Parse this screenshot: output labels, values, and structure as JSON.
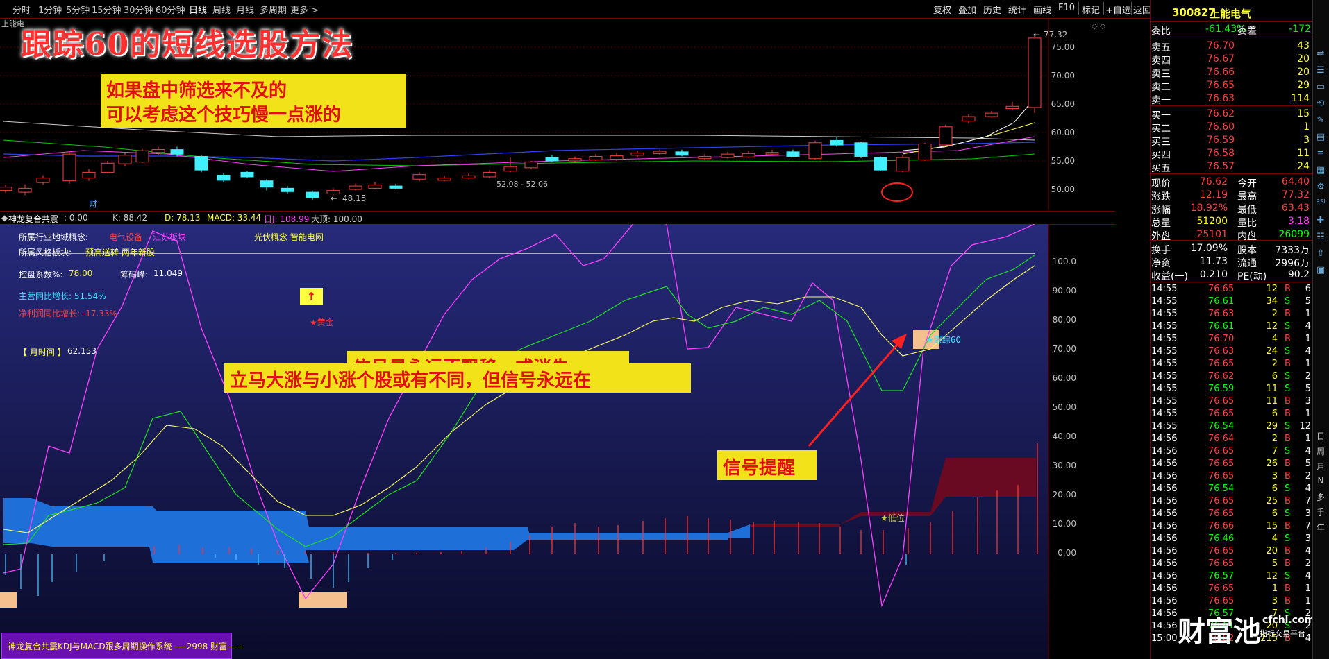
{
  "toolbar": {
    "periods": [
      "分时",
      "1分钟",
      "5分钟",
      "15分钟",
      "30分钟",
      "60分钟",
      "日线",
      "周线",
      "月线",
      "多周期",
      "更多 >"
    ],
    "active_period": "日线",
    "right_buttons": [
      "复权",
      "叠加",
      "历史",
      "统计",
      "画线",
      "F10",
      "标记",
      "+自选",
      "返回"
    ]
  },
  "stock": {
    "code": "300827",
    "name": "上能电气"
  },
  "main_chart": {
    "title_overlay": "跟踪60的短线选股方法",
    "note_line1": "如果盘中筛选来不及的",
    "note_line2": "可以考虑这个技巧慢一点涨的",
    "label_small": "上能电",
    "high_label": "77.32",
    "low_label": "48.15",
    "range_label": "52.08 - 52.06",
    "cai_label": "财",
    "y_ticks": [
      "75.00",
      "70.00",
      "65.00",
      "60.00",
      "55.00",
      "50.00"
    ]
  },
  "info_row": {
    "name": "神龙复合共震",
    "v0": ": 0.00",
    "k": "K: 88.42",
    "d": "D: 78.13",
    "macd": "MACD: 33.44",
    "j": "日J: 108.99",
    "big": "大顶: 100.00"
  },
  "indicator": {
    "industry_label": "所属行业地域概念:",
    "industry_v1": "电气设备",
    "industry_v2": "江苏板块",
    "concept": "光伏概念 智能电网",
    "style_label": "所属风格板块:",
    "style_value": "预高送转 两年新股",
    "control_label": "控盘系数%:",
    "control_value": "78.00",
    "chip_label": "筹码峰:",
    "chip_value": "11.049",
    "main_growth": "主营同比增长: 51.54%",
    "profit_growth": "净利润同比增长: -17.33%",
    "month_label": "【 月时间 】",
    "month_value": "62.153",
    "star_gold": "★黄金",
    "star_low": "★低位",
    "track_label": "跟踪60",
    "signal_text1": "信号是永远不飘移，或消失",
    "signal_text2": "立马大涨与小涨个股或有不同，但信号永远在",
    "signal_remind": "信号提醒",
    "arrow_box": "↑",
    "y_ticks": [
      "100.0",
      "90.00",
      "80.00",
      "70.00",
      "60.00",
      "50.00",
      "40.00",
      "30.00",
      "20.00",
      "10.00",
      "0.00"
    ],
    "footer": "神龙复合共震KDJ与MACD跟多周期操作系统 ----2998 财富-----"
  },
  "quote": {
    "weibi_label": "委比",
    "weibi_value": "-61.43%",
    "weicha_label": "委差",
    "weicha_value": "-172",
    "sells": [
      {
        "label": "卖五",
        "price": "76.70",
        "vol": "43"
      },
      {
        "label": "卖四",
        "price": "76.67",
        "vol": "20"
      },
      {
        "label": "卖三",
        "price": "76.66",
        "vol": "20"
      },
      {
        "label": "卖二",
        "price": "76.65",
        "vol": "29"
      },
      {
        "label": "卖一",
        "price": "76.63",
        "vol": "114"
      }
    ],
    "buys": [
      {
        "label": "买一",
        "price": "76.62",
        "vol": "15"
      },
      {
        "label": "买二",
        "price": "76.60",
        "vol": "1"
      },
      {
        "label": "买三",
        "price": "76.59",
        "vol": "3"
      },
      {
        "label": "买四",
        "price": "76.58",
        "vol": "11"
      },
      {
        "label": "买五",
        "price": "76.57",
        "vol": "24"
      }
    ],
    "stats": [
      {
        "l1": "现价",
        "v1": "76.62",
        "c1": "#ff4040",
        "l2": "今开",
        "v2": "64.40",
        "c2": "#ff4040"
      },
      {
        "l1": "涨跌",
        "v1": "12.19",
        "c1": "#ff4040",
        "l2": "最高",
        "v2": "77.32",
        "c2": "#ff4040"
      },
      {
        "l1": "涨幅",
        "v1": "18.92%",
        "c1": "#ff4040",
        "l2": "最低",
        "v2": "63.43",
        "c2": "#ff4040"
      },
      {
        "l1": "总量",
        "v1": "51200",
        "c1": "#ffff00",
        "l2": "量比",
        "v2": "3.18",
        "c2": "#ff40ff"
      },
      {
        "l1": "外盘",
        "v1": "25101",
        "c1": "#ff4040",
        "l2": "内盘",
        "v2": "26099",
        "c2": "#00ff00"
      }
    ],
    "stats2": [
      {
        "l1": "换手",
        "v1": "17.09%",
        "l2": "股本",
        "v2": "7333万"
      },
      {
        "l1": "净资",
        "v1": "11.73",
        "l2": "流通",
        "v2": "2996万"
      },
      {
        "l1": "收益(一)",
        "v1": "0.210",
        "l2": "PE(动)",
        "v2": "90.2"
      }
    ]
  },
  "ticks": [
    {
      "t": "14:55",
      "p": "76.65",
      "v": "12",
      "s": "B",
      "n": "6"
    },
    {
      "t": "14:55",
      "p": "76.61",
      "v": "34",
      "s": "S",
      "n": "5"
    },
    {
      "t": "14:55",
      "p": "76.63",
      "v": "2",
      "s": "B",
      "n": "1"
    },
    {
      "t": "14:55",
      "p": "76.61",
      "v": "12",
      "s": "S",
      "n": "4"
    },
    {
      "t": "14:55",
      "p": "76.70",
      "v": "4",
      "s": "B",
      "n": "1"
    },
    {
      "t": "14:55",
      "p": "76.63",
      "v": "24",
      "s": "S",
      "n": "4"
    },
    {
      "t": "14:55",
      "p": "76.65",
      "v": "2",
      "s": "B",
      "n": "1"
    },
    {
      "t": "14:55",
      "p": "76.62",
      "v": "6",
      "s": "S",
      "n": "2"
    },
    {
      "t": "14:55",
      "p": "76.59",
      "v": "11",
      "s": "S",
      "n": "5"
    },
    {
      "t": "14:55",
      "p": "76.65",
      "v": "11",
      "s": "B",
      "n": "3"
    },
    {
      "t": "14:55",
      "p": "76.65",
      "v": "6",
      "s": "B",
      "n": "1"
    },
    {
      "t": "14:55",
      "p": "76.54",
      "v": "29",
      "s": "S",
      "n": "12"
    },
    {
      "t": "14:56",
      "p": "76.64",
      "v": "2",
      "s": "B",
      "n": "1"
    },
    {
      "t": "14:56",
      "p": "76.65",
      "v": "7",
      "s": "S",
      "n": "4"
    },
    {
      "t": "14:56",
      "p": "76.65",
      "v": "26",
      "s": "B",
      "n": "5"
    },
    {
      "t": "14:56",
      "p": "76.65",
      "v": "3",
      "s": "B",
      "n": "2"
    },
    {
      "t": "14:56",
      "p": "76.54",
      "v": "6",
      "s": "S",
      "n": "4"
    },
    {
      "t": "14:56",
      "p": "76.65",
      "v": "25",
      "s": "B",
      "n": "7"
    },
    {
      "t": "14:56",
      "p": "76.65",
      "v": "6",
      "s": "S",
      "n": "3"
    },
    {
      "t": "14:56",
      "p": "76.66",
      "v": "15",
      "s": "B",
      "n": "7"
    },
    {
      "t": "14:56",
      "p": "76.46",
      "v": "4",
      "s": "S",
      "n": "3"
    },
    {
      "t": "14:56",
      "p": "76.65",
      "v": "20",
      "s": "B",
      "n": "4"
    },
    {
      "t": "14:56",
      "p": "76.65",
      "v": "5",
      "s": "B",
      "n": "2"
    },
    {
      "t": "14:56",
      "p": "76.57",
      "v": "12",
      "s": "S",
      "n": "4"
    },
    {
      "t": "14:56",
      "p": "76.65",
      "v": "1",
      "s": "B",
      "n": "1"
    },
    {
      "t": "14:56",
      "p": "76.65",
      "v": "3",
      "s": "B",
      "n": "1"
    },
    {
      "t": "14:56",
      "p": "76.57",
      "v": "7",
      "s": "S",
      "n": "2"
    },
    {
      "t": "14:56",
      "p": "76.61",
      "v": "20",
      "s": "S",
      "n": "2"
    },
    {
      "t": "15:00",
      "p": "76.62",
      "v": "215",
      "s": "B",
      "n": "4"
    }
  ],
  "watermark": {
    "brand": "财富池",
    "site": "cfchi.com",
    "slogan": "指标交易平台"
  },
  "side_text": [
    "日",
    "周",
    "月",
    "N",
    "多",
    "手",
    "年"
  ],
  "colors": {
    "up": "#ff4040",
    "down": "#00ffff",
    "bg": "#000000",
    "grid": "#7a0000",
    "indicator_bg": "#1a1f5e"
  }
}
